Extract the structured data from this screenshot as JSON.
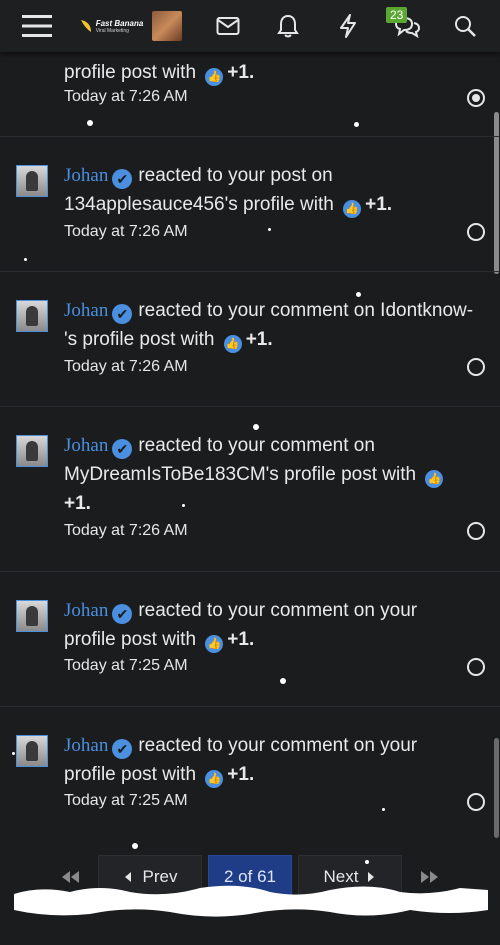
{
  "header": {
    "logo_brand": "Fast Banana",
    "logo_tag": "Viral Marketing",
    "conversation_badge": "23"
  },
  "notifications": [
    {
      "user": "",
      "action": "profile post with",
      "reaction": "+1.",
      "time": "Today at 7:26 AM",
      "partial": true,
      "read": true
    },
    {
      "user": "Johan",
      "action": "reacted to your post on 134applesauce456's profile with",
      "reaction": "+1.",
      "time": "Today at 7:26 AM",
      "read": false
    },
    {
      "user": "Johan",
      "action": "reacted to your comment on Idontknow-'s profile post with",
      "reaction": "+1.",
      "time": "Today at 7:26 AM",
      "read": false
    },
    {
      "user": "Johan",
      "action": "reacted to your comment on MyDreamIsToBe183CM's profile post with",
      "reaction": "+1.",
      "time": "Today at 7:26 AM",
      "read": false
    },
    {
      "user": "Johan",
      "action": "reacted to your comment on your profile post with",
      "reaction": "+1.",
      "time": "Today at 7:25 AM",
      "read": false
    },
    {
      "user": "Johan",
      "action": "reacted to your comment on your profile post with",
      "reaction": "+1.",
      "time": "Today at 7:25 AM",
      "read": false
    }
  ],
  "pagination": {
    "prev": "Prev",
    "current": "2 of 61",
    "next": "Next"
  },
  "colors": {
    "accent": "#4a8fe0",
    "page_active": "#1f3c86",
    "badge": "#5aa832"
  }
}
